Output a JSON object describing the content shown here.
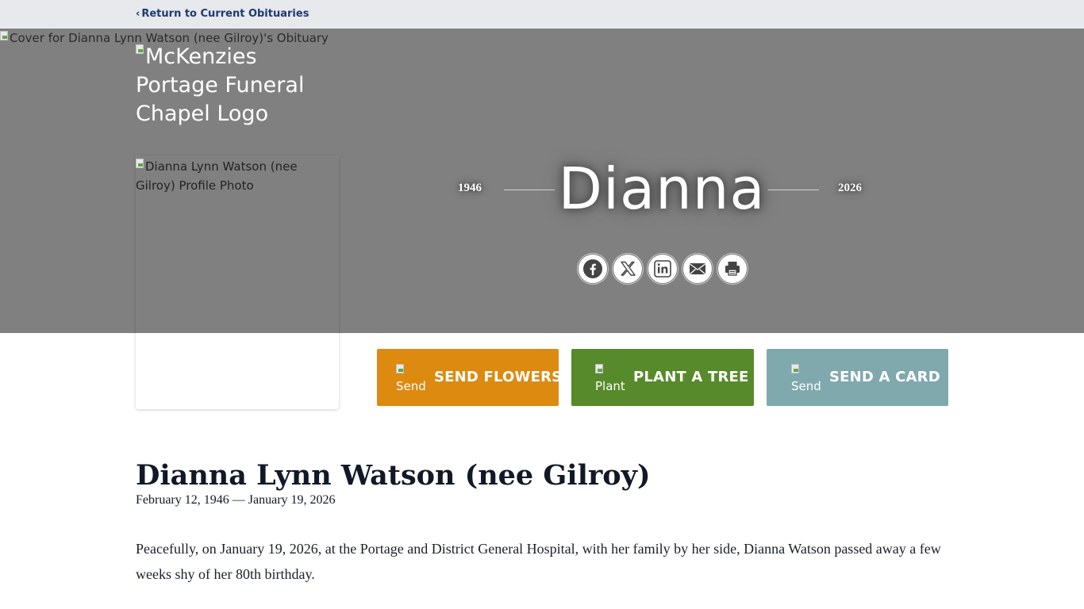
{
  "nav": {
    "back_chevron": "‹",
    "back_label": "Return to Current Obituaries"
  },
  "hero": {
    "cover_alt": "Cover for Dianna Lynn Watson (nee Gilroy)'s Obituary",
    "logo_alt": "McKenzies Portage Funeral Chapel Logo",
    "profile_alt": "Dianna Lynn Watson (nee Gilroy) Profile Photo",
    "birth_year": "1946",
    "death_year": "2026",
    "first_name": "Dianna",
    "share_icons": [
      "facebook-icon",
      "x-twitter-icon",
      "linkedin-icon",
      "email-icon",
      "print-icon"
    ]
  },
  "actions": {
    "flowers": {
      "img_alt": "Send",
      "label": "SEND FLOWERS",
      "color": "#dd8a10"
    },
    "tree": {
      "img_alt": "Plant",
      "label": "PLANT A TREE",
      "color": "#578a2a"
    },
    "card": {
      "img_alt": "Send",
      "label": "SEND A CARD",
      "color": "#80a9ae"
    }
  },
  "obituary": {
    "full_name": "Dianna Lynn Watson (nee Gilroy)",
    "dates": "February 12, 1946 — January 19, 2026",
    "paragraph_1": "Peacefully, on January 19, 2026, at the Portage and District General Hospital, with her family by her side, Dianna Watson passed away a few weeks shy of her 80th birthday."
  },
  "colors": {
    "hero_bg": "#808080",
    "topbar_bg": "#e7e9ec",
    "link": "#1d3a72"
  }
}
